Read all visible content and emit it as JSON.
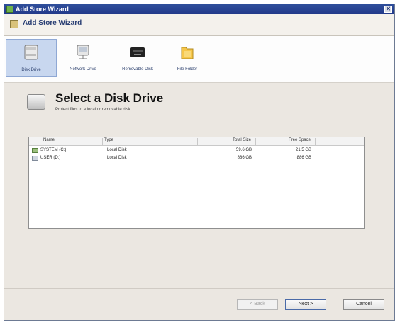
{
  "window": {
    "title": "Add Store Wizard"
  },
  "header": {
    "title": "Add Store Wizard"
  },
  "toolbar": {
    "items": [
      {
        "label": "Disk Drive",
        "icon": "disk-drive-icon",
        "selected": true
      },
      {
        "label": "Network Drive",
        "icon": "network-drive-icon"
      },
      {
        "label": "Removable Disk",
        "icon": "removable-disk-icon"
      },
      {
        "label": "File Folder",
        "icon": "file-folder-icon"
      }
    ]
  },
  "page": {
    "title": "Select a Disk Drive",
    "subtitle": "Protect files to a local or removable disk."
  },
  "table": {
    "columns": [
      "Name",
      "Type",
      "Total Size",
      "Free Space"
    ],
    "rows": [
      {
        "name": "SYSTEM (C:)",
        "type": "Local Disk",
        "total": "59.6 GB",
        "free": "21.5 GB"
      },
      {
        "name": "USER (D:)",
        "type": "Local Disk",
        "total": "886 GB",
        "free": "886 GB"
      }
    ]
  },
  "buttons": {
    "back": "< Back",
    "next": "Next >",
    "cancel": "Cancel"
  },
  "colors": {
    "titlebar": "#2f4f9b",
    "selection": "#c8d7ef",
    "accent": "#2a3f74"
  }
}
